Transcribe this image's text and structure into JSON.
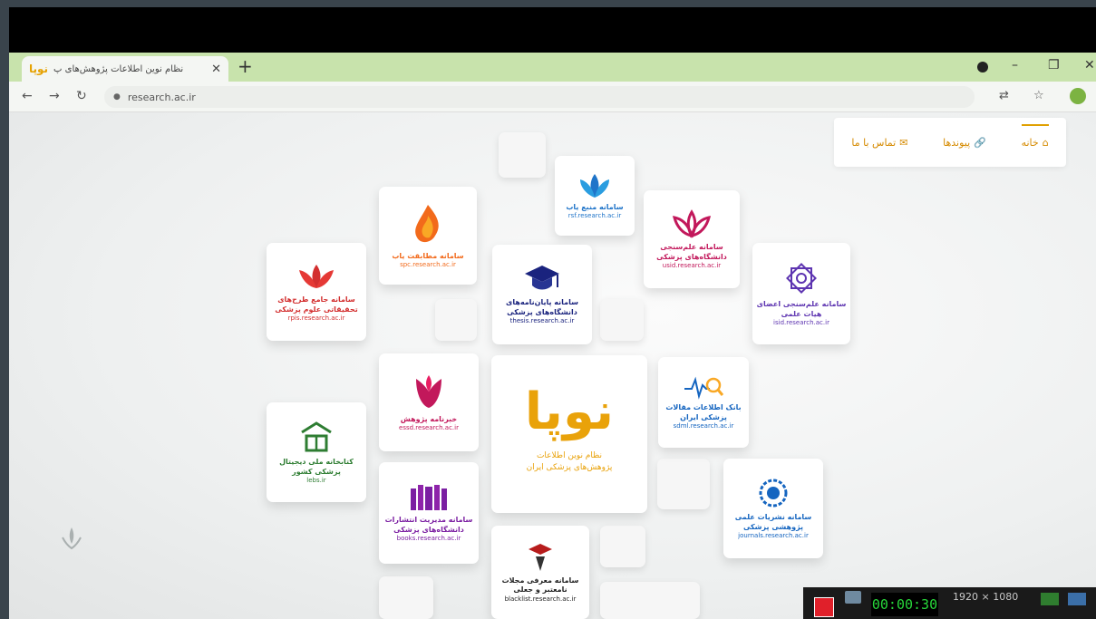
{
  "browser": {
    "tab_title": "نظام نوین اطلاعات پژوهش‌های پ",
    "tab_favicon": "نوپا",
    "tab_close": "✕",
    "new_tab": "+",
    "address": "research.ac.ir",
    "minimize": "–",
    "restore": "❐",
    "close": "✕"
  },
  "nav": {
    "home": "خانه",
    "links": "پیوندها",
    "contact": "تماس با ما"
  },
  "center": {
    "logo_word": "نوپا",
    "line1": "نظام نوین اطلاعات",
    "line2": "پژوهش‌های پزشکی ایران"
  },
  "cards": {
    "rsf": {
      "title": "سامانه منبع یاب",
      "url": "rsf.research.ac.ir",
      "color": "#1f74c9"
    },
    "spc": {
      "title": "سامانه مطابقت یاب",
      "url": "spc.research.ac.ir",
      "color": "#f26a1b"
    },
    "usid": {
      "title": "سامانه علم‌سنجی دانشگاه‌های پزشکی",
      "url": "usid.research.ac.ir",
      "color": "#c2185b"
    },
    "rpis": {
      "title": "سامانه جامع طرح‌های تحقیقاتی علوم پزشکی",
      "url": "rpis.research.ac.ir",
      "color": "#d32f2f"
    },
    "thesis": {
      "title": "سامانه پایان‌نامه‌های دانشگاه‌های پزشکی",
      "url": "thesis.research.ac.ir",
      "color": "#1a237e"
    },
    "isid": {
      "title": "سامانه علم‌سنجی اعضای هیات علمی",
      "url": "isid.research.ac.ir",
      "color": "#5e35b1"
    },
    "essd": {
      "title": "خبرنامه پژوهش",
      "url": "essd.research.ac.ir",
      "color": "#c2185b"
    },
    "sdml": {
      "title": "بانک اطلاعات مقالات پزشکی ایران",
      "url": "sdml.research.ac.ir",
      "color": "#1565c0"
    },
    "library": {
      "title": "کتابخانه ملی دیجیتال پزشکی کشور",
      "url": "lebs.ir",
      "color": "#2e7d32"
    },
    "books": {
      "title": "سامانه مدیریت انتشارات دانشگاه‌های پزشکی",
      "url": "books.research.ac.ir",
      "color": "#7b1fa2"
    },
    "journals": {
      "title": "سامانه نشریات علمی پژوهشی پزشکی",
      "url": "journals.research.ac.ir",
      "color": "#1565c0"
    },
    "blacklist": {
      "title": "سامانه معرفی مجلات نامعتبر و جعلی",
      "url": "blacklist.research.ac.ir",
      "color": "#b71c1c"
    }
  },
  "recorder": {
    "timer": "00:00:30",
    "resolution": "1920 × 1080"
  }
}
